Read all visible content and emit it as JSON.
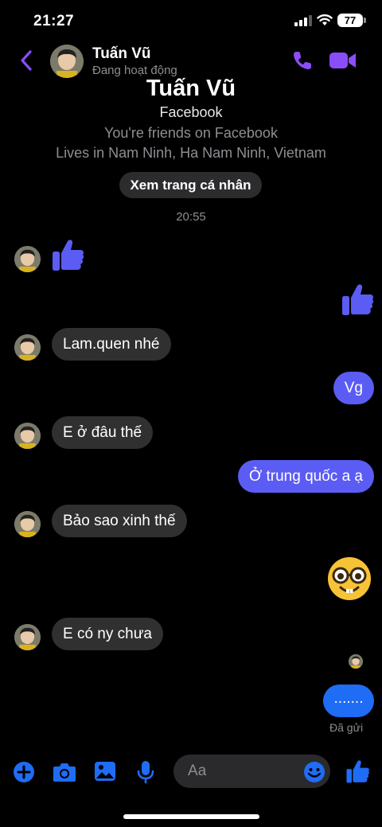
{
  "status_bar": {
    "time": "21:27",
    "battery": "77"
  },
  "header": {
    "name": "Tuấn Vũ",
    "status": "Đang hoạt động"
  },
  "profile": {
    "name": "Tuấn Vũ",
    "platform": "Facebook",
    "friends": "You're friends on Facebook",
    "lives": "Lives in Nam Ninh, Ha Nam Ninh, Vietnam",
    "view_profile": "Xem trang cá nhân"
  },
  "timestamp": "20:55",
  "messages": {
    "m3": "Lam.quen nhé",
    "m4": "Vg",
    "m5": "E ở đâu thế",
    "m6": "Ở trung quốc a ạ",
    "m7": "Bảo sao xinh thế",
    "m9": "E có ny chưa",
    "m10": "......."
  },
  "sent_status": "Đã gửi",
  "composer": {
    "placeholder": "Aa"
  },
  "colors": {
    "accent": "#5b5cf4",
    "blue": "#1f6cf5",
    "incoming": "#303030"
  }
}
